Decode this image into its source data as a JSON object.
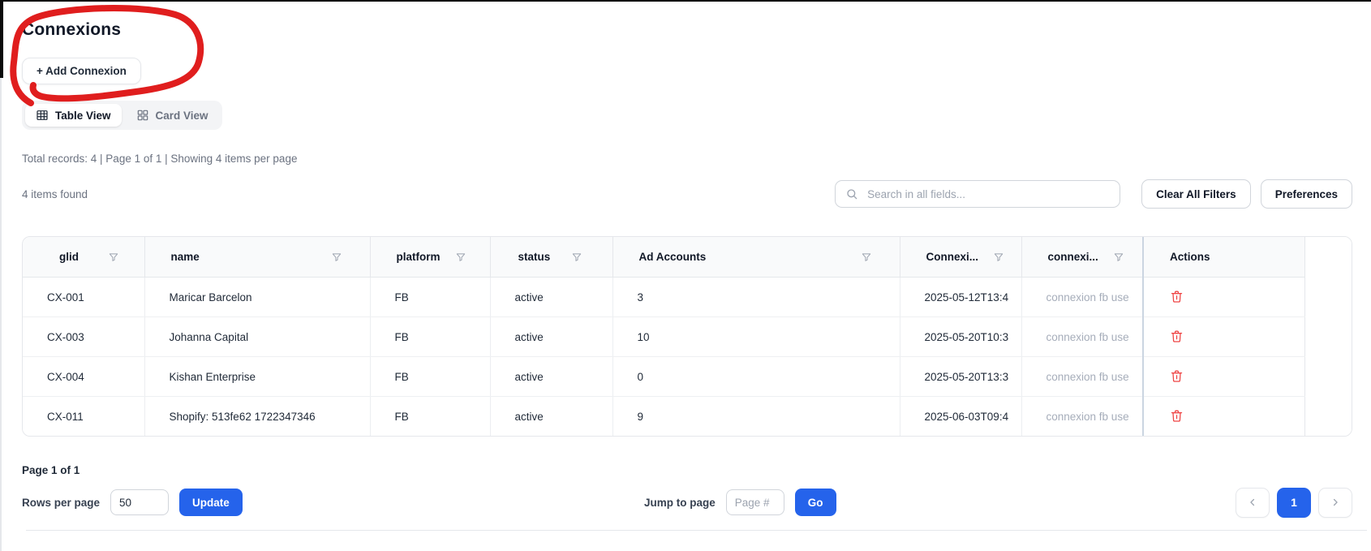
{
  "page": {
    "title": "Connexions",
    "add_button": "+ Add Connexion"
  },
  "view_toggle": {
    "table_label": "Table View",
    "card_label": "Card View"
  },
  "summary": "Total records: 4 | Page 1 of 1 | Showing 4 items per page",
  "items_found": "4 items found",
  "toolbar": {
    "search_placeholder": "Search in all fields...",
    "clear_filters_label": "Clear All Filters",
    "preferences_label": "Preferences"
  },
  "table": {
    "columns": [
      {
        "key": "glid",
        "label": "glid",
        "filter": true
      },
      {
        "key": "name",
        "label": "name",
        "filter": true
      },
      {
        "key": "platform",
        "label": "platform",
        "filter": true
      },
      {
        "key": "status",
        "label": "status",
        "filter": true
      },
      {
        "key": "ad_accounts",
        "label": "Ad Accounts",
        "filter": true
      },
      {
        "key": "connexion_date",
        "label": "Connexi...",
        "filter": true
      },
      {
        "key": "connexion_note",
        "label": "connexi...",
        "filter": true
      },
      {
        "key": "actions",
        "label": "Actions",
        "filter": false
      }
    ],
    "rows": [
      {
        "glid": "CX-001",
        "name": "Maricar Barcelon",
        "platform": "FB",
        "status": "active",
        "ad_accounts": "3",
        "connexion_date": "2025-05-12T13:4",
        "connexion_note": "connexion fb use"
      },
      {
        "glid": "CX-003",
        "name": "Johanna Capital",
        "platform": "FB",
        "status": "active",
        "ad_accounts": "10",
        "connexion_date": "2025-05-20T10:3",
        "connexion_note": "connexion fb use"
      },
      {
        "glid": "CX-004",
        "name": "Kishan Enterprise",
        "platform": "FB",
        "status": "active",
        "ad_accounts": "0",
        "connexion_date": "2025-05-20T13:3",
        "connexion_note": "connexion fb use"
      },
      {
        "glid": "CX-011",
        "name": "Shopify: 513fe62 1722347346",
        "platform": "FB",
        "status": "active",
        "ad_accounts": "9",
        "connexion_date": "2025-06-03T09:4",
        "connexion_note": "connexion fb use"
      }
    ]
  },
  "footer": {
    "page_info": "Page 1 of 1",
    "rows_per_page_label": "Rows per page",
    "rows_per_page_value": "50",
    "update_label": "Update",
    "jump_label": "Jump to page",
    "jump_placeholder": "Page #",
    "go_label": "Go",
    "current_page": "1"
  },
  "colors": {
    "accent_blue": "#2563eb",
    "danger_red": "#ef4444",
    "annotation_red": "#e01e1e",
    "muted_text": "#6b7280",
    "border": "#e5e7eb"
  }
}
